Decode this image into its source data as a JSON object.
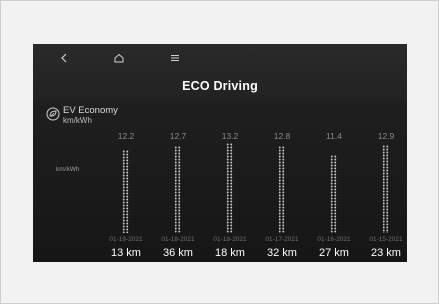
{
  "nav": {
    "back_icon": "chevron-left-icon",
    "home_icon": "home-icon",
    "menu_icon": "menu-icon"
  },
  "screen": {
    "title": "ECO Driving"
  },
  "economy": {
    "label": "EV Economy",
    "unit": "km/kWh",
    "icon": "leaf-gauge-icon"
  },
  "chart": {
    "y_label": "km/kWh"
  },
  "chart_data": {
    "type": "bar",
    "categories": [
      "01-19-2021",
      "01-18-2021",
      "01-18-2021",
      "01-17-2021",
      "01-16-2021",
      "01-15-2021"
    ],
    "values": [
      12.2,
      12.7,
      13.2,
      12.8,
      11.4,
      12.9
    ],
    "distances": [
      "13 km",
      "36 km",
      "18 km",
      "32 km",
      "27 km",
      "23 km"
    ],
    "ylabel": "km/kWh",
    "ylim": [
      0,
      13.2
    ]
  },
  "colors": {
    "background": "#1b1b1b",
    "bar_dots": "#c8c8c8",
    "title": "#ffffff"
  }
}
